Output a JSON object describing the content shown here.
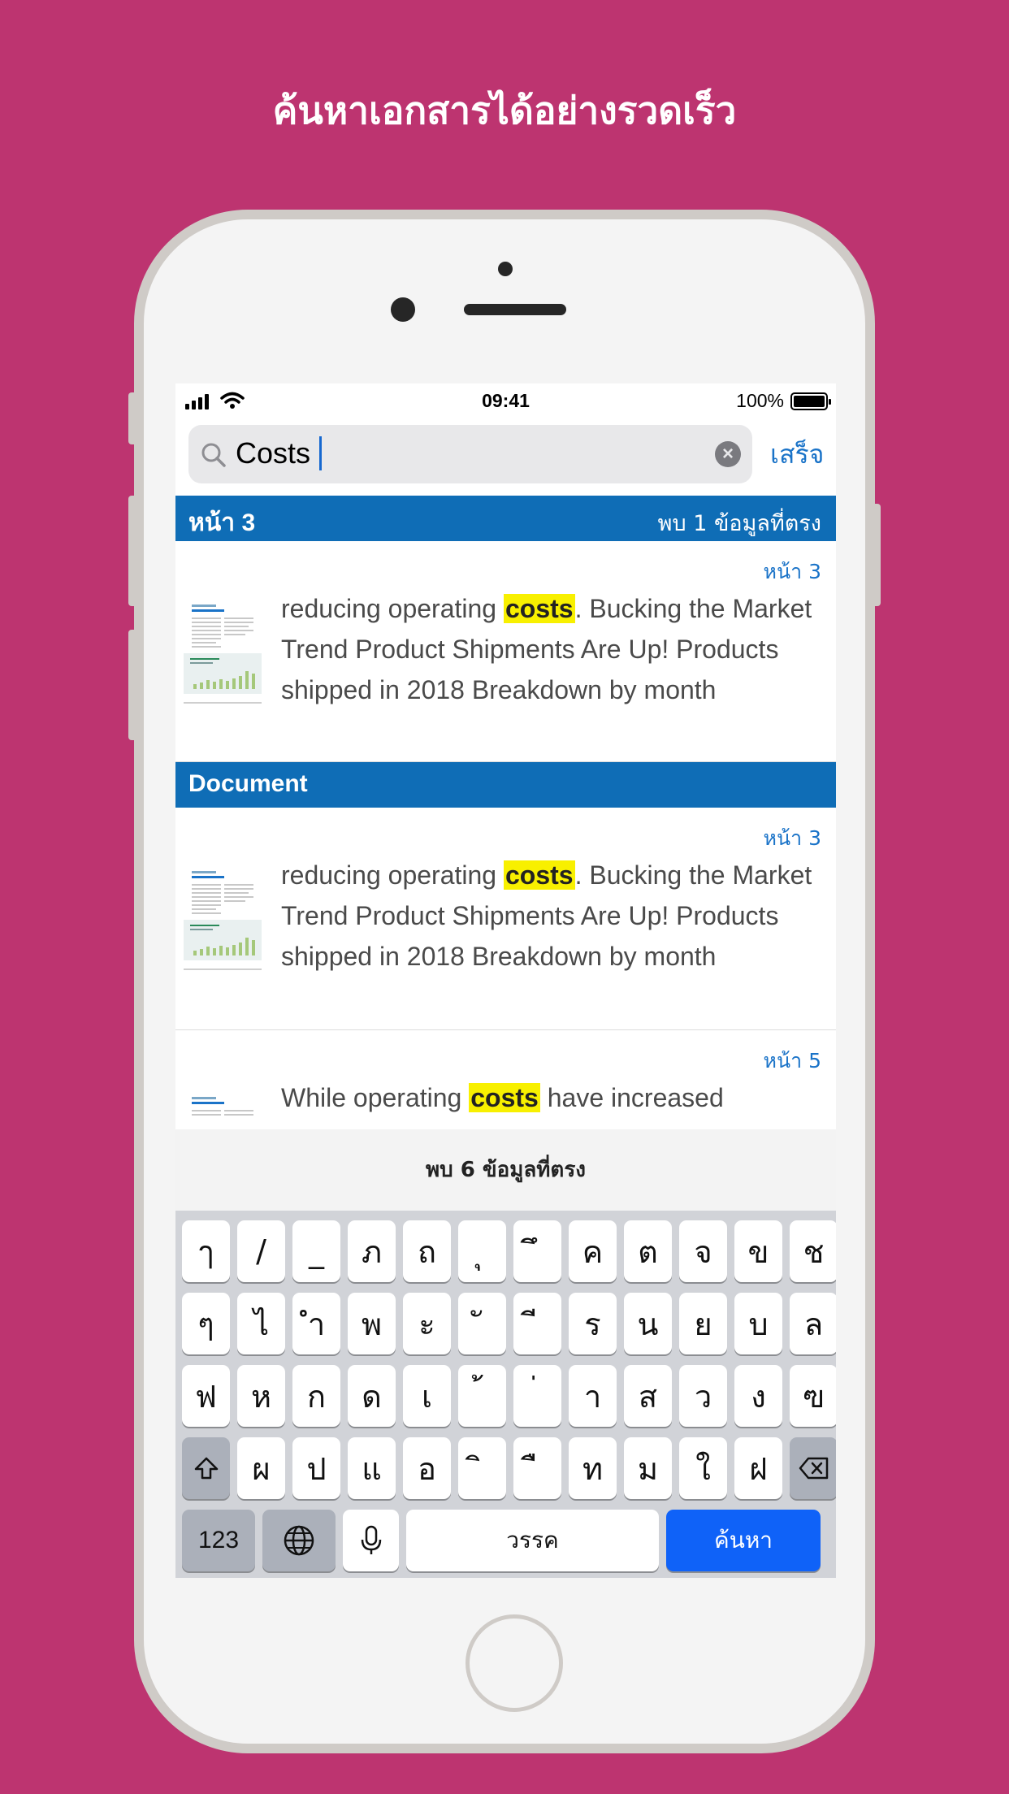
{
  "headline": "ค้นหาเอกสารได้อย่างรวดเร็ว",
  "status_bar": {
    "time": "09:41",
    "battery": "100%"
  },
  "search": {
    "value": "Costs",
    "done_label": "เสร็จ"
  },
  "sections": [
    {
      "title": "หน้า 3",
      "count": "พบ 1 ข้อมูลที่ตรง"
    },
    {
      "title": "Document"
    }
  ],
  "results": [
    {
      "page": "หน้า 3",
      "before": "reducing operating ",
      "highlight": "costs",
      "after": ". Bucking the Market Trend Product Shipments Are Up! Products shipped in 2018 Breakdown by month"
    },
    {
      "page": "หน้า 3",
      "before": "reducing operating ",
      "highlight": "costs",
      "after": ". Bucking the Market Trend Product Shipments Are Up! Products shipped in 2018 Breakdown by month"
    },
    {
      "page": "หน้า 5",
      "before": "While operating ",
      "highlight": "costs",
      "after": " have increased"
    }
  ],
  "footer": "พบ 6 ข้อมูลที่ตรง",
  "keyboard": {
    "row1": [
      "ๅ",
      "/",
      "_",
      "ภ",
      "ถ",
      "ุ",
      "ึ",
      "ค",
      "ต",
      "จ",
      "ข",
      "ช"
    ],
    "row2": [
      "ๆ",
      "ไ",
      "ำ",
      "พ",
      "ะ",
      "ั",
      "ี",
      "ร",
      "น",
      "ย",
      "บ",
      "ล"
    ],
    "row3": [
      "ฟ",
      "ห",
      "ก",
      "ด",
      "เ",
      "้",
      "่",
      "า",
      "ส",
      "ว",
      "ง",
      "ฃ"
    ],
    "row4": [
      "ผ",
      "ป",
      "แ",
      "อ",
      "ิ",
      "ื",
      "ท",
      "ม",
      "ใ",
      "ฝ"
    ],
    "numbers_label": "123",
    "space_label": "วรรค",
    "search_label": "ค้นหา"
  }
}
